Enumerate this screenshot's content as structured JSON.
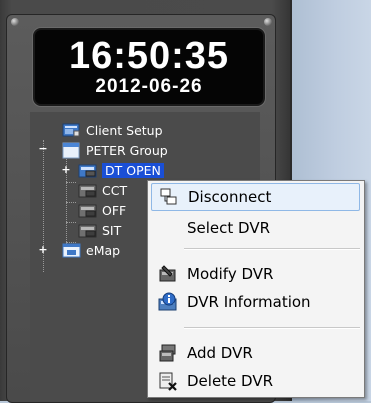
{
  "clock": {
    "time": "16:50:35",
    "date": "2012-06-26"
  },
  "tree": {
    "items": [
      {
        "label": "Client Setup",
        "icon": "client-setup-icon"
      },
      {
        "label": "PETER Group",
        "icon": "group-folder-icon",
        "expander": "−"
      },
      {
        "label": "DT OPEN",
        "icon": "dvr-icon",
        "expander": "+",
        "selected": true
      },
      {
        "label": "CCT",
        "icon": "dvr-icon"
      },
      {
        "label": "OFF",
        "icon": "dvr-icon"
      },
      {
        "label": "SIT",
        "icon": "dvr-icon"
      },
      {
        "label": "eMap",
        "icon": "emap-icon",
        "expander": "+"
      }
    ]
  },
  "context_menu": {
    "items": [
      {
        "label": "Disconnect",
        "icon": "disconnect-icon",
        "highlighted": true
      },
      {
        "label": "Select DVR",
        "icon": ""
      },
      {
        "label": "Modify DVR",
        "icon": "modify-dvr-icon"
      },
      {
        "label": "DVR Information",
        "icon": "dvr-info-icon"
      },
      {
        "label": "Add DVR",
        "icon": "add-dvr-icon"
      },
      {
        "label": "Delete DVR",
        "icon": "delete-dvr-icon"
      }
    ]
  },
  "colors": {
    "selection": "#1a4fd6",
    "menu_highlight": "#e8f1fb",
    "panel": "#4b4b4b"
  }
}
